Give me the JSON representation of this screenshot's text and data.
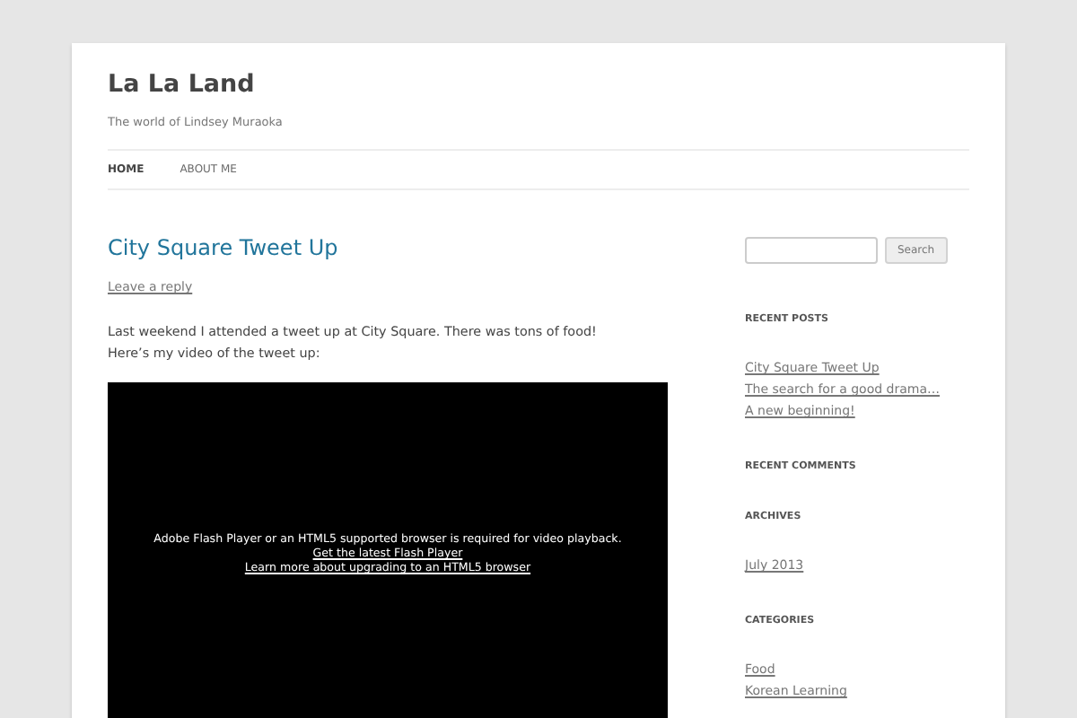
{
  "site": {
    "title": "La La Land",
    "tagline": "The world of Lindsey Muraoka"
  },
  "nav": [
    {
      "label": "HOME",
      "selected": true
    },
    {
      "label": "ABOUT ME",
      "selected": false
    }
  ],
  "post": {
    "title": "City Square Tweet Up",
    "reply_link": "Leave a reply",
    "paragraph_lines": [
      "Last weekend I attended a tweet up at City Square. There was tons of food!",
      "Here’s my video of the tweet up:"
    ],
    "video": {
      "message": "Adobe Flash Player or an HTML5 supported browser is required for video playback.",
      "links": [
        "Get the latest Flash Player",
        "Learn more about upgrading to an HTML5 browser"
      ]
    }
  },
  "sidebar": {
    "search": {
      "button": "Search"
    },
    "widgets": [
      {
        "title": "RECENT POSTS",
        "links": [
          "City Square Tweet Up",
          "The search for a good drama…",
          "A new beginning!"
        ]
      },
      {
        "title": "RECENT COMMENTS"
      },
      {
        "title": "ARCHIVES",
        "links": [
          "July 2013"
        ]
      },
      {
        "title": "CATEGORIES",
        "links": [
          "Food",
          "Korean Learning"
        ]
      }
    ]
  }
}
